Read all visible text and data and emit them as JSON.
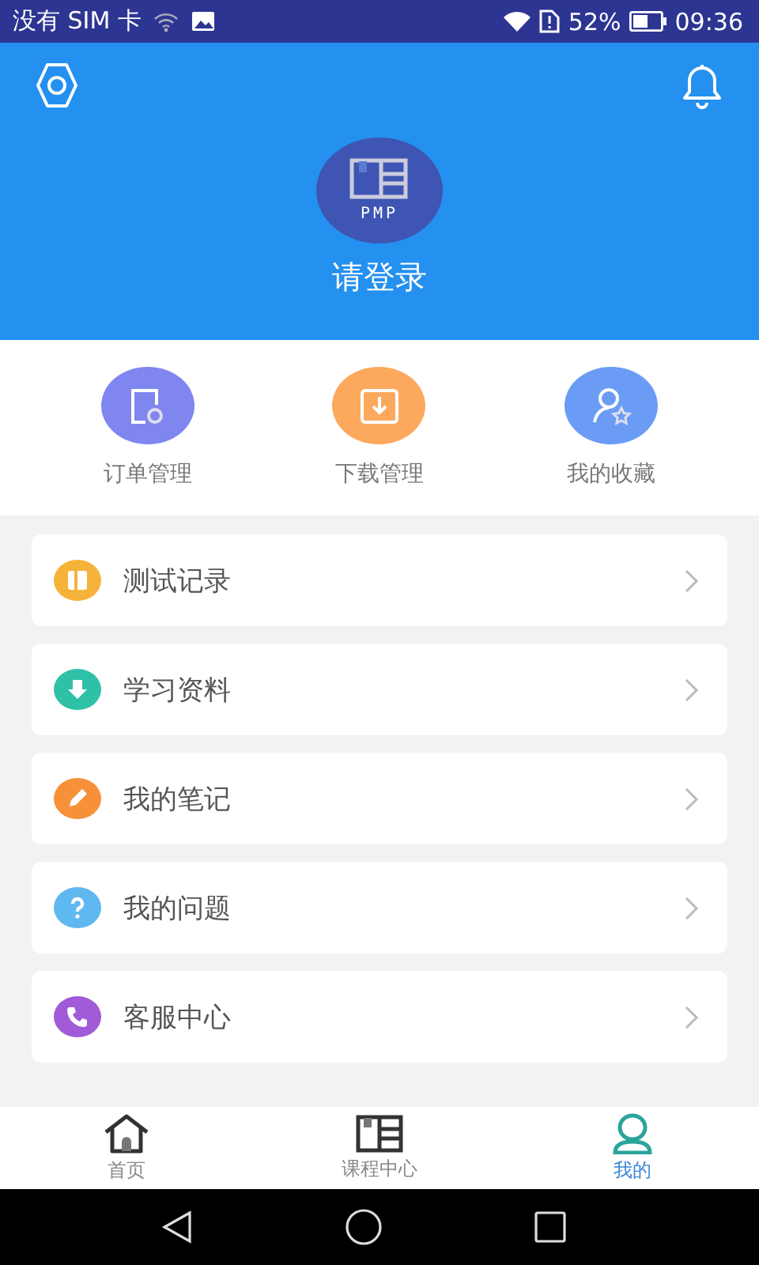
{
  "status_bar": {
    "carrier": "没有 SIM 卡",
    "battery": "52%",
    "time": "09:36"
  },
  "header": {
    "logo_text": "PMP",
    "login": "请登录"
  },
  "quick_actions": [
    {
      "kind": "order",
      "label": "订单管理",
      "color": "#7f86f0"
    },
    {
      "kind": "download",
      "label": "下载管理",
      "color": "#fca95d"
    },
    {
      "kind": "favorite",
      "label": "我的收藏",
      "color": "#6a9cf5"
    }
  ],
  "menu": [
    {
      "kind": "record",
      "label": "测试记录",
      "color": "#f6b33a"
    },
    {
      "kind": "download",
      "label": "学习资料",
      "color": "#2fc1a7"
    },
    {
      "kind": "note",
      "label": "我的笔记",
      "color": "#f6913a"
    },
    {
      "kind": "question",
      "label": "我的问题",
      "color": "#5fb8ef"
    },
    {
      "kind": "phone",
      "label": "客服中心",
      "color": "#a15bd6"
    }
  ],
  "tabs": [
    {
      "kind": "home",
      "label": "首页",
      "selected": false
    },
    {
      "kind": "course",
      "label": "课程中心",
      "selected": false
    },
    {
      "kind": "me",
      "label": "我的",
      "selected": true
    }
  ]
}
